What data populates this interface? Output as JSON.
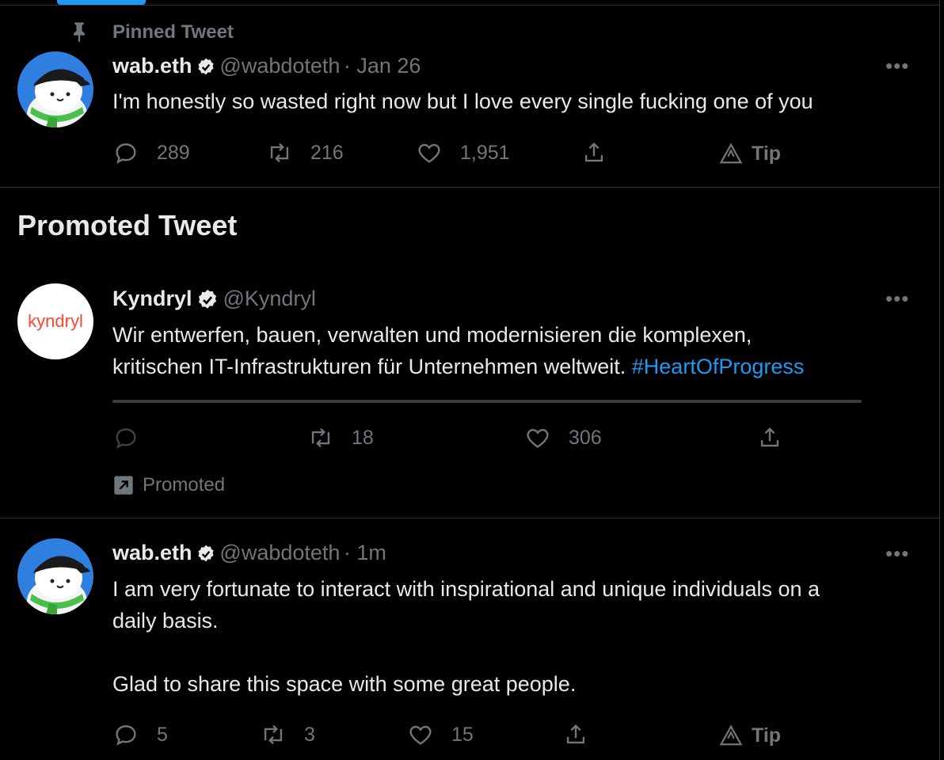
{
  "pinned_label": "Pinned Tweet",
  "tweet1": {
    "name": "wab.eth",
    "handle": "@wabdoteth",
    "time": "· Jan 26",
    "text": "I'm honestly so wasted right now but I love every single fucking one of you",
    "replies": "289",
    "retweets": "216",
    "likes": "1,951",
    "tip": "Tip"
  },
  "promoted_heading": "Promoted Tweet",
  "tweet2": {
    "avatar_text": "kyndryl",
    "name": "Kyndryl",
    "handle": "@Kyndryl",
    "text_line1": "Wir entwerfen, bauen, verwalten und modernisieren die komplexen,",
    "text_line2": "kritischen IT-Infrastrukturen für Unternehmen weltweit.",
    "hashtag": "#HeartOfProgress",
    "retweets": "18",
    "likes": "306",
    "promoted_label": "Promoted"
  },
  "tweet3": {
    "name": "wab.eth",
    "handle": "@wabdoteth",
    "time": "· 1m",
    "text_line1": "I am very fortunate to interact with inspirational and unique individuals on a",
    "text_line2": "daily basis.",
    "text_line3": "Glad to share this space with some great people.",
    "replies": "5",
    "retweets": "3",
    "likes": "15",
    "tip": "Tip"
  },
  "colors": {
    "accent": "#1d9bf0",
    "muted": "#71767b",
    "background": "#000000",
    "border": "#2f3336",
    "kyndryl_brand": "#ff462d"
  }
}
